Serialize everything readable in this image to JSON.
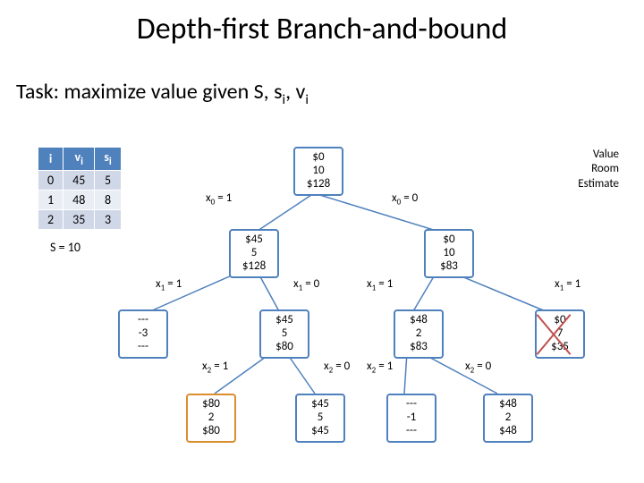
{
  "title": "Depth-first Branch-and-bound",
  "task_prefix": "Task: maximize value given S, s",
  "task_mid": ",  v",
  "table": {
    "headers": [
      "i",
      "v",
      "s"
    ],
    "header_sub": [
      "",
      "i",
      "i"
    ],
    "rows": [
      [
        "0",
        "45",
        "5"
      ],
      [
        "1",
        "48",
        "8"
      ],
      [
        "2",
        "35",
        "3"
      ]
    ]
  },
  "capacity": "S = 10",
  "legend": {
    "l1": "Value",
    "l2": "Room",
    "l3": "Estimate"
  },
  "nodes": {
    "root": [
      "$0",
      "10",
      "$128"
    ],
    "L": [
      "$45",
      "5",
      "$128"
    ],
    "R": [
      "$0",
      "10",
      "$83"
    ],
    "LL": [
      "---",
      "-3",
      "---"
    ],
    "LR": [
      "$45",
      "5",
      "$80"
    ],
    "RL": [
      "$48",
      "2",
      "$83"
    ],
    "RR": [
      "$0",
      "7",
      "$35"
    ],
    "LRa": [
      "$80",
      "2",
      "$80"
    ],
    "LRb": [
      "$45",
      "5",
      "$45"
    ],
    "RLa": [
      "---",
      "-1",
      "---"
    ],
    "RLb": [
      "$48",
      "2",
      "$48"
    ]
  },
  "edges": {
    "e_root_L": "x",
    "e_root_L_sub": "0",
    "e_root_L_suf": " = 1",
    "e_root_R": "x",
    "e_root_R_sub": "0",
    "e_root_R_suf": " = 0",
    "e_L_LL": "x",
    "e_L_LL_sub": "1",
    "e_L_LL_suf": " = 1",
    "e_L_LR": "x",
    "e_L_LR_sub": "1",
    "e_L_LR_suf": " = 0",
    "e_R_RL": "x",
    "e_R_RL_sub": "1",
    "e_R_RL_suf": " = 1",
    "e_R_RR": "x",
    "e_R_RR_sub": "1",
    "e_R_RR_suf": " = 1",
    "e_LR_a": "x",
    "e_LR_a_sub": "2",
    "e_LR_a_suf": " = 1",
    "e_LR_b": "x",
    "e_LR_b_sub": "2",
    "e_LR_b_suf": " = 0",
    "e_RL_a": "x",
    "e_RL_a_sub": "2",
    "e_RL_a_suf": " = 1",
    "e_RL_b": "x",
    "e_RL_b_sub": "2",
    "e_RL_b_suf": " = 0"
  }
}
